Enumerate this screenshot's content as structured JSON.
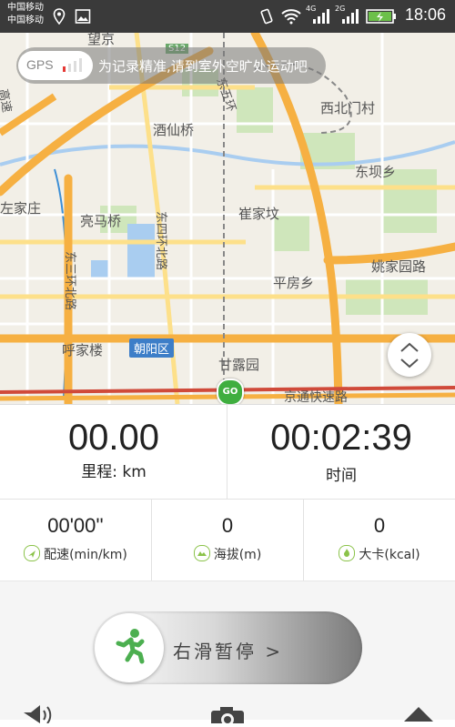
{
  "status_bar": {
    "carrier_1": "中国移动",
    "carrier_2": "中国移动",
    "network_1": "4G",
    "network_2": "2G",
    "time": "18:06"
  },
  "map": {
    "gps_label": "GPS",
    "gps_message": "为记录精准,请到室外空旷处运动吧",
    "labels": {
      "wangjing": "望京",
      "s12": "S12",
      "dong_wu_huan": "东五环",
      "xibei_menchun": "西北门村",
      "jiuxianqiao": "酒仙桥",
      "dongba": "东坝乡",
      "zuojiazhuang": "左家庄",
      "liangmaqiao": "亮马桥",
      "dongsihuan": "东四环北路",
      "cuigezhuang": "崔家坟",
      "dongsanhuan": "东三环北路",
      "yaojia": "姚家园路",
      "pingfang": "平房乡",
      "hujialou": "呼家楼",
      "chaoyang": "朝阳区",
      "ganlu": "甘露园",
      "jingtong": "京通快速路",
      "gaosu": "高速"
    },
    "start_marker": "GO"
  },
  "stats": {
    "distance_value": "00.00",
    "distance_label": "里程: km",
    "time_value": "00:02:39",
    "time_label": "时间",
    "pace_value": "00'00''",
    "pace_label": "配速(min/km)",
    "altitude_value": "0",
    "altitude_label": "海拔(m)",
    "calories_value": "0",
    "calories_label": "大卡(kcal)"
  },
  "controls": {
    "slide_label": "右滑暂停 >"
  },
  "colors": {
    "accent_green": "#8bc34a",
    "runner_green": "#4caf50",
    "road_orange": "#f6b042",
    "district_blue": "#3d7ec8"
  }
}
